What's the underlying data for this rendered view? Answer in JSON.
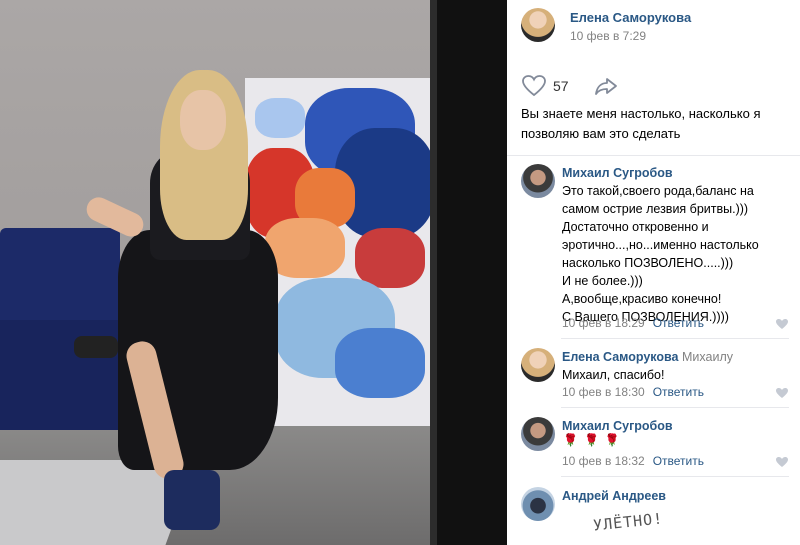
{
  "post": {
    "author": "Елена Саморукова",
    "date": "10 фев в 7:29",
    "likes_count": "57",
    "text": "Вы знаете меня настолько, насколько я позволяю вам это сделать"
  },
  "comments": [
    {
      "author": "Михаил Сугробов",
      "addressee": "",
      "lines": [
        "Это такой,своего рода,баланс на",
        "самом острие лезвия бритвы.)))",
        "Достаточно откровенно и",
        "эротично...,но...именно настолько",
        "насколько ПОЗВОЛЕНО.....)))",
        "И не более.)))",
        "А,вообще,красиво конечно!",
        "С Вашего ПОЗВОЛЕНИЯ.))))"
      ],
      "date": "10 фев в 18:29",
      "reply_label": "Ответить"
    },
    {
      "author": "Елена Саморукова",
      "addressee": "Михаилу",
      "lines": [
        "Михаил, спасибо!"
      ],
      "date": "10 фев в 18:30",
      "reply_label": "Ответить"
    },
    {
      "author": "Михаил Сугробов",
      "addressee": "",
      "lines": [],
      "roses": [
        "🌹",
        "🌹",
        "🌹"
      ],
      "date": "10 фев в 18:32",
      "reply_label": "Ответить"
    },
    {
      "author": "Андрей Андреев",
      "addressee": "",
      "handwritten": "УЛЁТНО!"
    }
  ],
  "colors": {
    "link": "#2a5885",
    "meta": "#828282",
    "gutter": "#111111"
  },
  "icons": [
    "heart-icon",
    "share-icon",
    "like-icon"
  ]
}
